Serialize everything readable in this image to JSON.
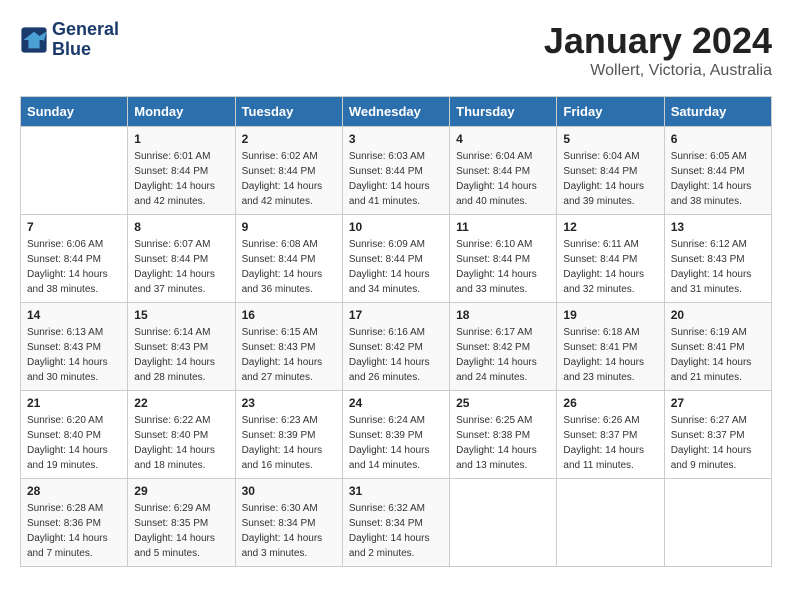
{
  "logo": {
    "line1": "General",
    "line2": "Blue"
  },
  "title": "January 2024",
  "subtitle": "Wollert, Victoria, Australia",
  "days_of_week": [
    "Sunday",
    "Monday",
    "Tuesday",
    "Wednesday",
    "Thursday",
    "Friday",
    "Saturday"
  ],
  "weeks": [
    [
      {
        "day": "",
        "sunrise": "",
        "sunset": "",
        "daylight": ""
      },
      {
        "day": "1",
        "sunrise": "6:01 AM",
        "sunset": "8:44 PM",
        "daylight": "14 hours and 42 minutes."
      },
      {
        "day": "2",
        "sunrise": "6:02 AM",
        "sunset": "8:44 PM",
        "daylight": "14 hours and 42 minutes."
      },
      {
        "day": "3",
        "sunrise": "6:03 AM",
        "sunset": "8:44 PM",
        "daylight": "14 hours and 41 minutes."
      },
      {
        "day": "4",
        "sunrise": "6:04 AM",
        "sunset": "8:44 PM",
        "daylight": "14 hours and 40 minutes."
      },
      {
        "day": "5",
        "sunrise": "6:04 AM",
        "sunset": "8:44 PM",
        "daylight": "14 hours and 39 minutes."
      },
      {
        "day": "6",
        "sunrise": "6:05 AM",
        "sunset": "8:44 PM",
        "daylight": "14 hours and 38 minutes."
      }
    ],
    [
      {
        "day": "7",
        "sunrise": "6:06 AM",
        "sunset": "8:44 PM",
        "daylight": "14 hours and 38 minutes."
      },
      {
        "day": "8",
        "sunrise": "6:07 AM",
        "sunset": "8:44 PM",
        "daylight": "14 hours and 37 minutes."
      },
      {
        "day": "9",
        "sunrise": "6:08 AM",
        "sunset": "8:44 PM",
        "daylight": "14 hours and 36 minutes."
      },
      {
        "day": "10",
        "sunrise": "6:09 AM",
        "sunset": "8:44 PM",
        "daylight": "14 hours and 34 minutes."
      },
      {
        "day": "11",
        "sunrise": "6:10 AM",
        "sunset": "8:44 PM",
        "daylight": "14 hours and 33 minutes."
      },
      {
        "day": "12",
        "sunrise": "6:11 AM",
        "sunset": "8:44 PM",
        "daylight": "14 hours and 32 minutes."
      },
      {
        "day": "13",
        "sunrise": "6:12 AM",
        "sunset": "8:43 PM",
        "daylight": "14 hours and 31 minutes."
      }
    ],
    [
      {
        "day": "14",
        "sunrise": "6:13 AM",
        "sunset": "8:43 PM",
        "daylight": "14 hours and 30 minutes."
      },
      {
        "day": "15",
        "sunrise": "6:14 AM",
        "sunset": "8:43 PM",
        "daylight": "14 hours and 28 minutes."
      },
      {
        "day": "16",
        "sunrise": "6:15 AM",
        "sunset": "8:43 PM",
        "daylight": "14 hours and 27 minutes."
      },
      {
        "day": "17",
        "sunrise": "6:16 AM",
        "sunset": "8:42 PM",
        "daylight": "14 hours and 26 minutes."
      },
      {
        "day": "18",
        "sunrise": "6:17 AM",
        "sunset": "8:42 PM",
        "daylight": "14 hours and 24 minutes."
      },
      {
        "day": "19",
        "sunrise": "6:18 AM",
        "sunset": "8:41 PM",
        "daylight": "14 hours and 23 minutes."
      },
      {
        "day": "20",
        "sunrise": "6:19 AM",
        "sunset": "8:41 PM",
        "daylight": "14 hours and 21 minutes."
      }
    ],
    [
      {
        "day": "21",
        "sunrise": "6:20 AM",
        "sunset": "8:40 PM",
        "daylight": "14 hours and 19 minutes."
      },
      {
        "day": "22",
        "sunrise": "6:22 AM",
        "sunset": "8:40 PM",
        "daylight": "14 hours and 18 minutes."
      },
      {
        "day": "23",
        "sunrise": "6:23 AM",
        "sunset": "8:39 PM",
        "daylight": "14 hours and 16 minutes."
      },
      {
        "day": "24",
        "sunrise": "6:24 AM",
        "sunset": "8:39 PM",
        "daylight": "14 hours and 14 minutes."
      },
      {
        "day": "25",
        "sunrise": "6:25 AM",
        "sunset": "8:38 PM",
        "daylight": "14 hours and 13 minutes."
      },
      {
        "day": "26",
        "sunrise": "6:26 AM",
        "sunset": "8:37 PM",
        "daylight": "14 hours and 11 minutes."
      },
      {
        "day": "27",
        "sunrise": "6:27 AM",
        "sunset": "8:37 PM",
        "daylight": "14 hours and 9 minutes."
      }
    ],
    [
      {
        "day": "28",
        "sunrise": "6:28 AM",
        "sunset": "8:36 PM",
        "daylight": "14 hours and 7 minutes."
      },
      {
        "day": "29",
        "sunrise": "6:29 AM",
        "sunset": "8:35 PM",
        "daylight": "14 hours and 5 minutes."
      },
      {
        "day": "30",
        "sunrise": "6:30 AM",
        "sunset": "8:34 PM",
        "daylight": "14 hours and 3 minutes."
      },
      {
        "day": "31",
        "sunrise": "6:32 AM",
        "sunset": "8:34 PM",
        "daylight": "14 hours and 2 minutes."
      },
      {
        "day": "",
        "sunrise": "",
        "sunset": "",
        "daylight": ""
      },
      {
        "day": "",
        "sunrise": "",
        "sunset": "",
        "daylight": ""
      },
      {
        "day": "",
        "sunrise": "",
        "sunset": "",
        "daylight": ""
      }
    ]
  ]
}
